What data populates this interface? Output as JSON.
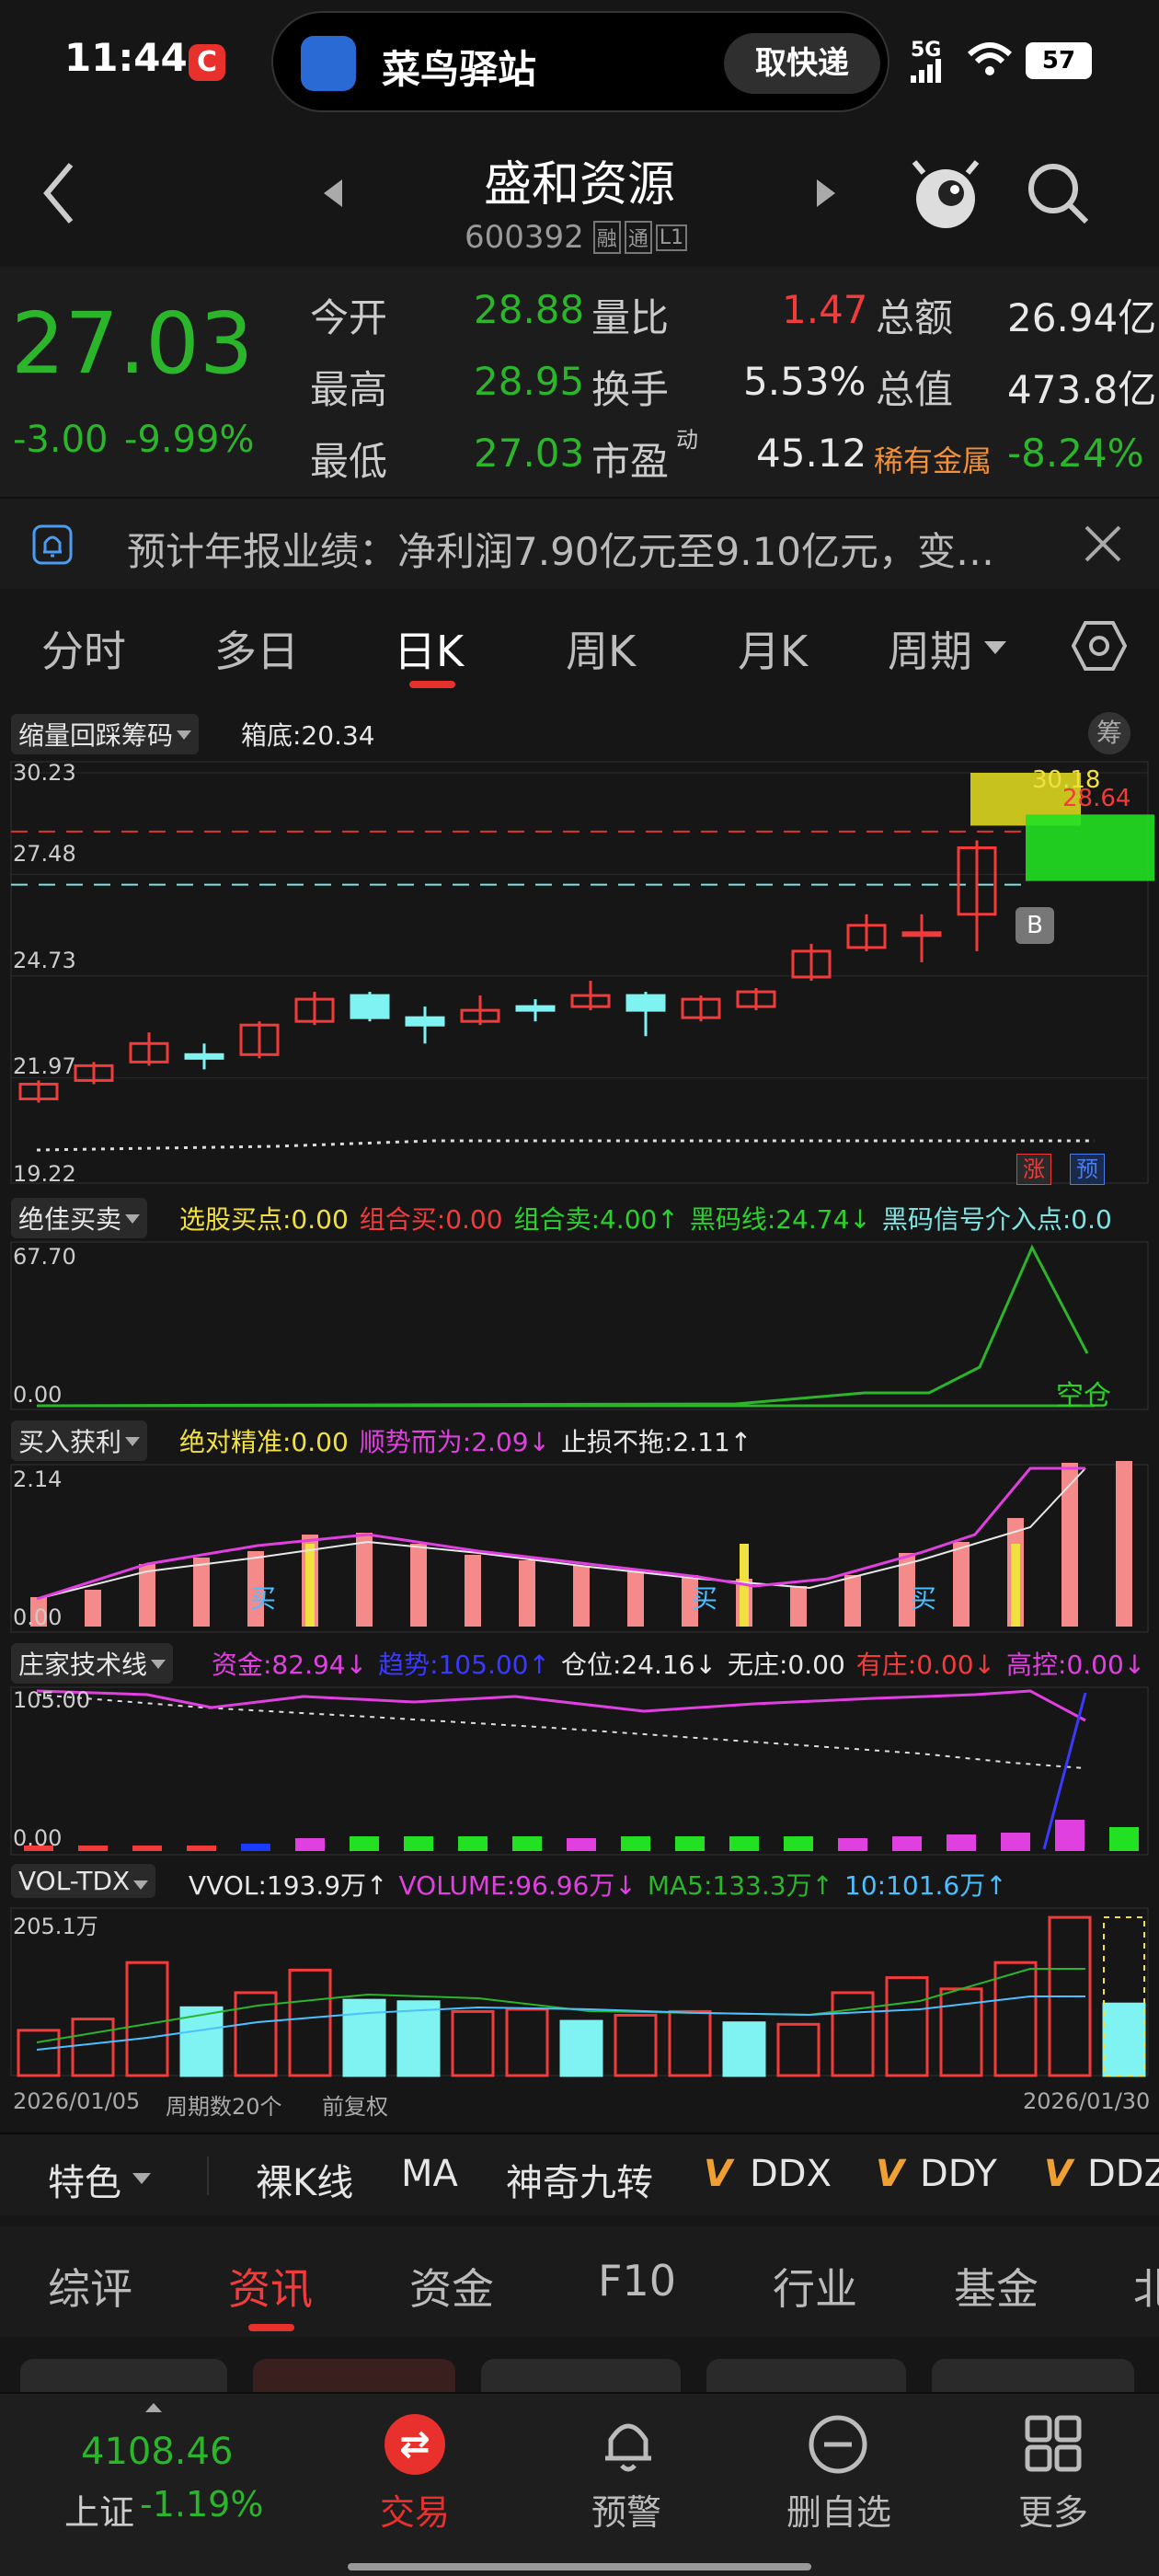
{
  "status_bar": {
    "time": "11:44",
    "notif_text": "菜鸟驿站",
    "notif_button": "取快递",
    "network": "5G",
    "battery": "57"
  },
  "header": {
    "title": "盛和资源",
    "code": "600392",
    "badges": [
      "融",
      "通",
      "L1"
    ]
  },
  "quote": {
    "price": "27.03",
    "change": "-3.00",
    "change_pct": "-9.99%",
    "open_label": "今开",
    "open": "28.88",
    "high_label": "最高",
    "high": "28.95",
    "low_label": "最低",
    "low": "27.03",
    "vol_ratio_label": "量比",
    "vol_ratio": "1.47",
    "turnover_label": "换手",
    "turnover": "5.53%",
    "pe_label": "市盈",
    "pe_sup": "动",
    "pe": "45.12",
    "amount_label": "总额",
    "amount": "26.94亿",
    "mcap_label": "总值",
    "mcap": "473.8亿",
    "sector_label": "稀有金属",
    "sector_change": "-8.24%"
  },
  "notice": {
    "text": "预计年报业绩：净利润7.90亿元至9.10亿元，变…"
  },
  "period_tabs": [
    "分时",
    "多日",
    "日K",
    "周K",
    "月K",
    "周期"
  ],
  "active_period": "日K",
  "kline_panel": {
    "indicator": "缩量回踩筹码",
    "box_label": "箱底:20.34",
    "chip_button": "筹",
    "y_ticks": [
      "30.23",
      "27.48",
      "24.73",
      "21.97",
      "19.22"
    ],
    "chip_labels": [
      "30.18",
      "28.64"
    ],
    "b_marker": "B",
    "zhang": "涨",
    "yu": "预"
  },
  "panel2": {
    "indicator": "绝佳买卖",
    "items": [
      {
        "text": "选股买点:0.00",
        "color": "#f0e040"
      },
      {
        "text": "组合买:0.00",
        "color": "#f23b3b"
      },
      {
        "text": "组合卖:4.00↑",
        "color": "#2bd12b"
      },
      {
        "text": "黑码线:24.74↓",
        "color": "#2bd12b"
      },
      {
        "text": "黑码信号介入点:0.0",
        "color": "#7fe3e3"
      }
    ],
    "y_top": "67.70",
    "y_bottom": "0.00",
    "note": "空仓"
  },
  "panel3": {
    "indicator": "买入获利",
    "items": [
      {
        "text": "绝对精准:0.00",
        "color": "#f0e040"
      },
      {
        "text": "顺势而为:2.09↓",
        "color": "#e040e0"
      },
      {
        "text": "止损不拖:2.11↑",
        "color": "#e8e8e8"
      }
    ],
    "y_top": "2.14",
    "y_bottom": "0.00",
    "buy_mark": "买"
  },
  "panel4": {
    "indicator": "庄家技术线",
    "items": [
      {
        "text": "资金:82.94↓",
        "color": "#e040e0"
      },
      {
        "text": "趋势:105.00↑",
        "color": "#3a3aff"
      },
      {
        "text": "仓位:24.16↓",
        "color": "#e8e8e8"
      },
      {
        "text": "无庄:0.00",
        "color": "#e8e8e8"
      },
      {
        "text": "有庄:0.00↓",
        "color": "#f23b3b"
      },
      {
        "text": "高控:0.00↓",
        "color": "#e040e0"
      }
    ],
    "y_top": "105.00",
    "y_bottom": "0.00"
  },
  "panel5": {
    "indicator": "VOL-TDX",
    "items": [
      {
        "text": "VVOL:193.9万↑",
        "color": "#e8e8e8"
      },
      {
        "text": "VOLUME:96.96万↓",
        "color": "#e040e0"
      },
      {
        "text": "MA5:133.3万↑",
        "color": "#2bb52b"
      },
      {
        "text": "10:101.6万↑",
        "color": "#4ac0ff"
      }
    ],
    "y_top": "205.1万"
  },
  "axis_footer": {
    "start": "2026/01/05",
    "count": "周期数20个",
    "adj": "前复权",
    "end": "2026/01/30"
  },
  "toolbar": {
    "feature": "特色",
    "items": [
      "裸K线",
      "MA",
      "神奇九转",
      "DDX",
      "DDY",
      "DDZ"
    ]
  },
  "info_tabs": [
    "综评",
    "资讯",
    "资金",
    "F10",
    "行业",
    "基金",
    "北"
  ],
  "active_info_tab": "资讯",
  "bottom_nav": {
    "index_value": "4108.46",
    "index_name": "上证",
    "index_change": "-1.19%",
    "trade": "交易",
    "alert": "预警",
    "remove": "删自选",
    "more": "更多"
  },
  "colors": {
    "up": "#f23b3b",
    "down": "#2bb52b",
    "bg": "#161616",
    "cyan": "#7ff2f2"
  },
  "chart_data": {
    "type": "candlestick",
    "title": "日K",
    "ylim": [
      19.22,
      30.23
    ],
    "candles": [
      {
        "o": 21.4,
        "c": 21.8,
        "h": 21.9,
        "l": 21.3
      },
      {
        "o": 21.9,
        "c": 22.3,
        "h": 22.4,
        "l": 21.8
      },
      {
        "o": 22.4,
        "c": 22.9,
        "h": 23.2,
        "l": 22.3
      },
      {
        "o": 22.6,
        "c": 22.5,
        "h": 22.9,
        "l": 22.2
      },
      {
        "o": 22.6,
        "c": 23.4,
        "h": 23.5,
        "l": 22.5
      },
      {
        "o": 23.5,
        "c": 24.1,
        "h": 24.3,
        "l": 23.4
      },
      {
        "o": 24.2,
        "c": 23.6,
        "h": 24.3,
        "l": 23.5
      },
      {
        "o": 23.6,
        "c": 23.4,
        "h": 23.9,
        "l": 22.9
      },
      {
        "o": 23.5,
        "c": 23.8,
        "h": 24.2,
        "l": 23.4
      },
      {
        "o": 23.9,
        "c": 23.8,
        "h": 24.1,
        "l": 23.5
      },
      {
        "o": 23.9,
        "c": 24.2,
        "h": 24.6,
        "l": 23.8
      },
      {
        "o": 24.2,
        "c": 23.8,
        "h": 24.3,
        "l": 23.1
      },
      {
        "o": 23.6,
        "c": 24.1,
        "h": 24.2,
        "l": 23.5
      },
      {
        "o": 23.9,
        "c": 24.3,
        "h": 24.4,
        "l": 23.8
      },
      {
        "o": 24.7,
        "c": 25.4,
        "h": 25.6,
        "l": 24.6
      },
      {
        "o": 25.5,
        "c": 26.1,
        "h": 26.4,
        "l": 25.4
      },
      {
        "o": 25.9,
        "c": 25.9,
        "h": 26.4,
        "l": 25.1
      },
      {
        "o": 26.4,
        "c": 28.2,
        "h": 28.4,
        "l": 25.4
      }
    ],
    "volume": [
      60,
      75,
      150,
      90,
      110,
      140,
      100,
      98,
      85,
      88,
      72,
      80,
      85,
      70,
      68,
      110,
      130,
      115,
      150,
      210,
      95
    ],
    "volume_up": [
      true,
      true,
      true,
      false,
      true,
      true,
      false,
      false,
      true,
      true,
      false,
      true,
      true,
      false,
      true,
      true,
      true,
      true,
      true,
      true,
      false
    ]
  }
}
